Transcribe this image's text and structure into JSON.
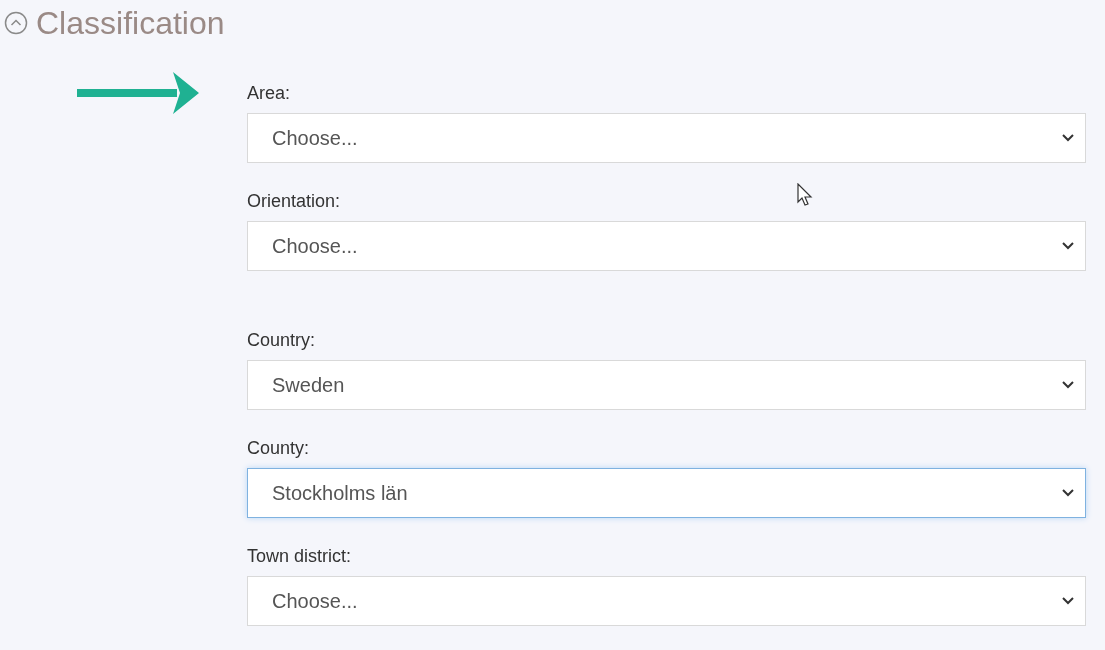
{
  "section": {
    "title": "Classification",
    "expanded": true
  },
  "groups": [
    {
      "fields": [
        {
          "label": "Area:",
          "value": "Choose...",
          "focused": false
        },
        {
          "label": "Orientation:",
          "value": "Choose...",
          "focused": false
        }
      ]
    },
    {
      "fields": [
        {
          "label": "Country:",
          "value": "Sweden",
          "focused": false
        },
        {
          "label": "County:",
          "value": "Stockholms län",
          "focused": true
        },
        {
          "label": "Town district:",
          "value": "Choose...",
          "focused": false
        }
      ]
    }
  ]
}
